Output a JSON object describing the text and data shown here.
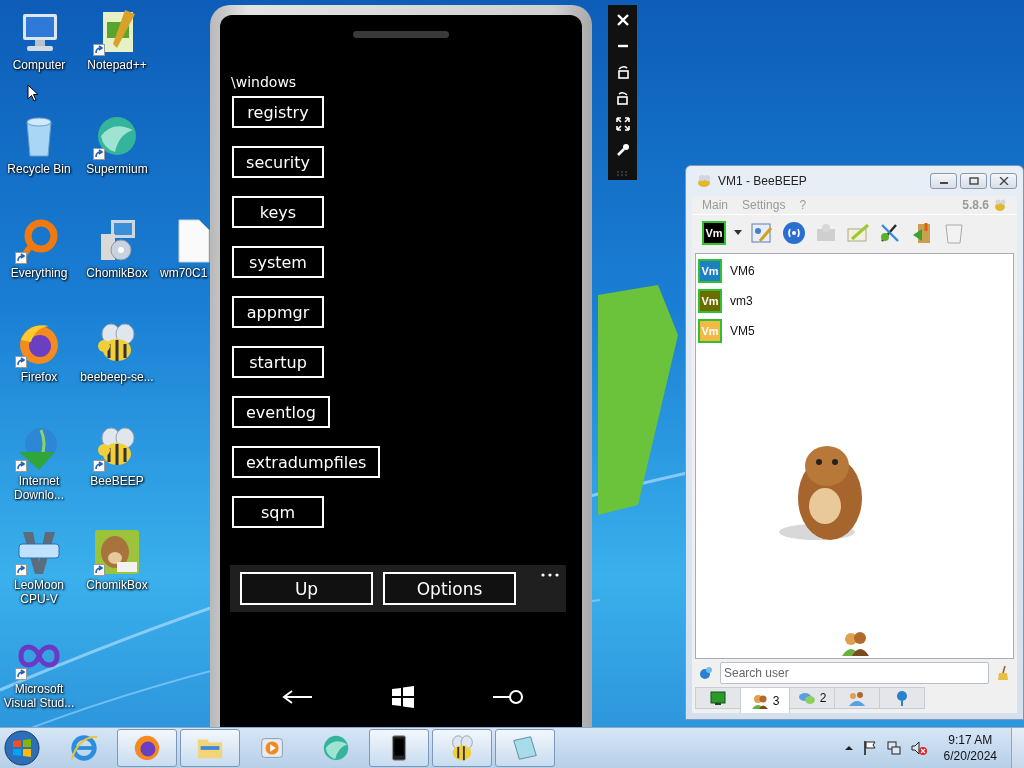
{
  "desktop_icons": [
    {
      "label": "Computer",
      "kind": "computer",
      "shortcut": false
    },
    {
      "label": "Notepad++",
      "kind": "notepad",
      "shortcut": true
    },
    {
      "label": "Recycle Bin",
      "kind": "recycle",
      "shortcut": false
    },
    {
      "label": "Supermium",
      "kind": "swirl",
      "shortcut": true
    },
    {
      "label": "Everything",
      "kind": "ring",
      "shortcut": true
    },
    {
      "label": "ChomikBox",
      "kind": "installer",
      "shortcut": false
    },
    {
      "label": "wm70C1",
      "kind": "file",
      "shortcut": false
    },
    {
      "label": "Firefox",
      "kind": "fox",
      "shortcut": true
    },
    {
      "label": "beebeep-se...",
      "kind": "bee",
      "shortcut": false
    },
    {
      "label": "Internet Downlo...",
      "kind": "download",
      "shortcut": true
    },
    {
      "label": "BeeBEEP",
      "kind": "bee",
      "shortcut": true
    },
    {
      "label": "LeoMoon CPU-V",
      "kind": "cpu",
      "shortcut": true
    },
    {
      "label": "ChomikBox",
      "kind": "hamster",
      "shortcut": true
    },
    {
      "label": "Microsoft Visual Stud...",
      "kind": "infinity",
      "shortcut": true
    }
  ],
  "phone": {
    "path": "\\windows",
    "folders": [
      "registry",
      "security",
      "keys",
      "system",
      "appmgr",
      "startup",
      "eventlog",
      "extradumpfiles",
      "sqm"
    ],
    "app_bar": [
      "Up",
      "Options"
    ]
  },
  "beebeep": {
    "title": "VM1 - BeeBEEP",
    "menu": [
      "Main",
      "Settings",
      "?"
    ],
    "version": "5.8.6",
    "my_avatar": "Vm",
    "users": [
      {
        "name": "VM6",
        "avatar": "Vm",
        "color": "#1e7fc4"
      },
      {
        "name": "vm3",
        "avatar": "Vm",
        "color": "#6b6b00"
      },
      {
        "name": "VM5",
        "avatar": "Vm",
        "color": "#f2b945"
      }
    ],
    "search": {
      "placeholder": "Search user"
    },
    "tabs": [
      {
        "kind": "monitor",
        "selected": false
      },
      {
        "kind": "users",
        "count": "3",
        "selected": true
      },
      {
        "kind": "chats",
        "count": "2",
        "selected": false
      },
      {
        "kind": "groups",
        "selected": false
      },
      {
        "kind": "network",
        "selected": false
      }
    ]
  },
  "taskbar": {
    "items": [
      {
        "kind": "ie",
        "running": false
      },
      {
        "kind": "fox",
        "running": true
      },
      {
        "kind": "folder",
        "running": true
      },
      {
        "kind": "media",
        "running": false
      },
      {
        "kind": "swirl",
        "running": false
      },
      {
        "kind": "phone",
        "running": true
      },
      {
        "kind": "bee",
        "running": true
      },
      {
        "kind": "notepad",
        "running": true
      }
    ],
    "time": "9:17 AM",
    "date": "6/20/2024"
  }
}
